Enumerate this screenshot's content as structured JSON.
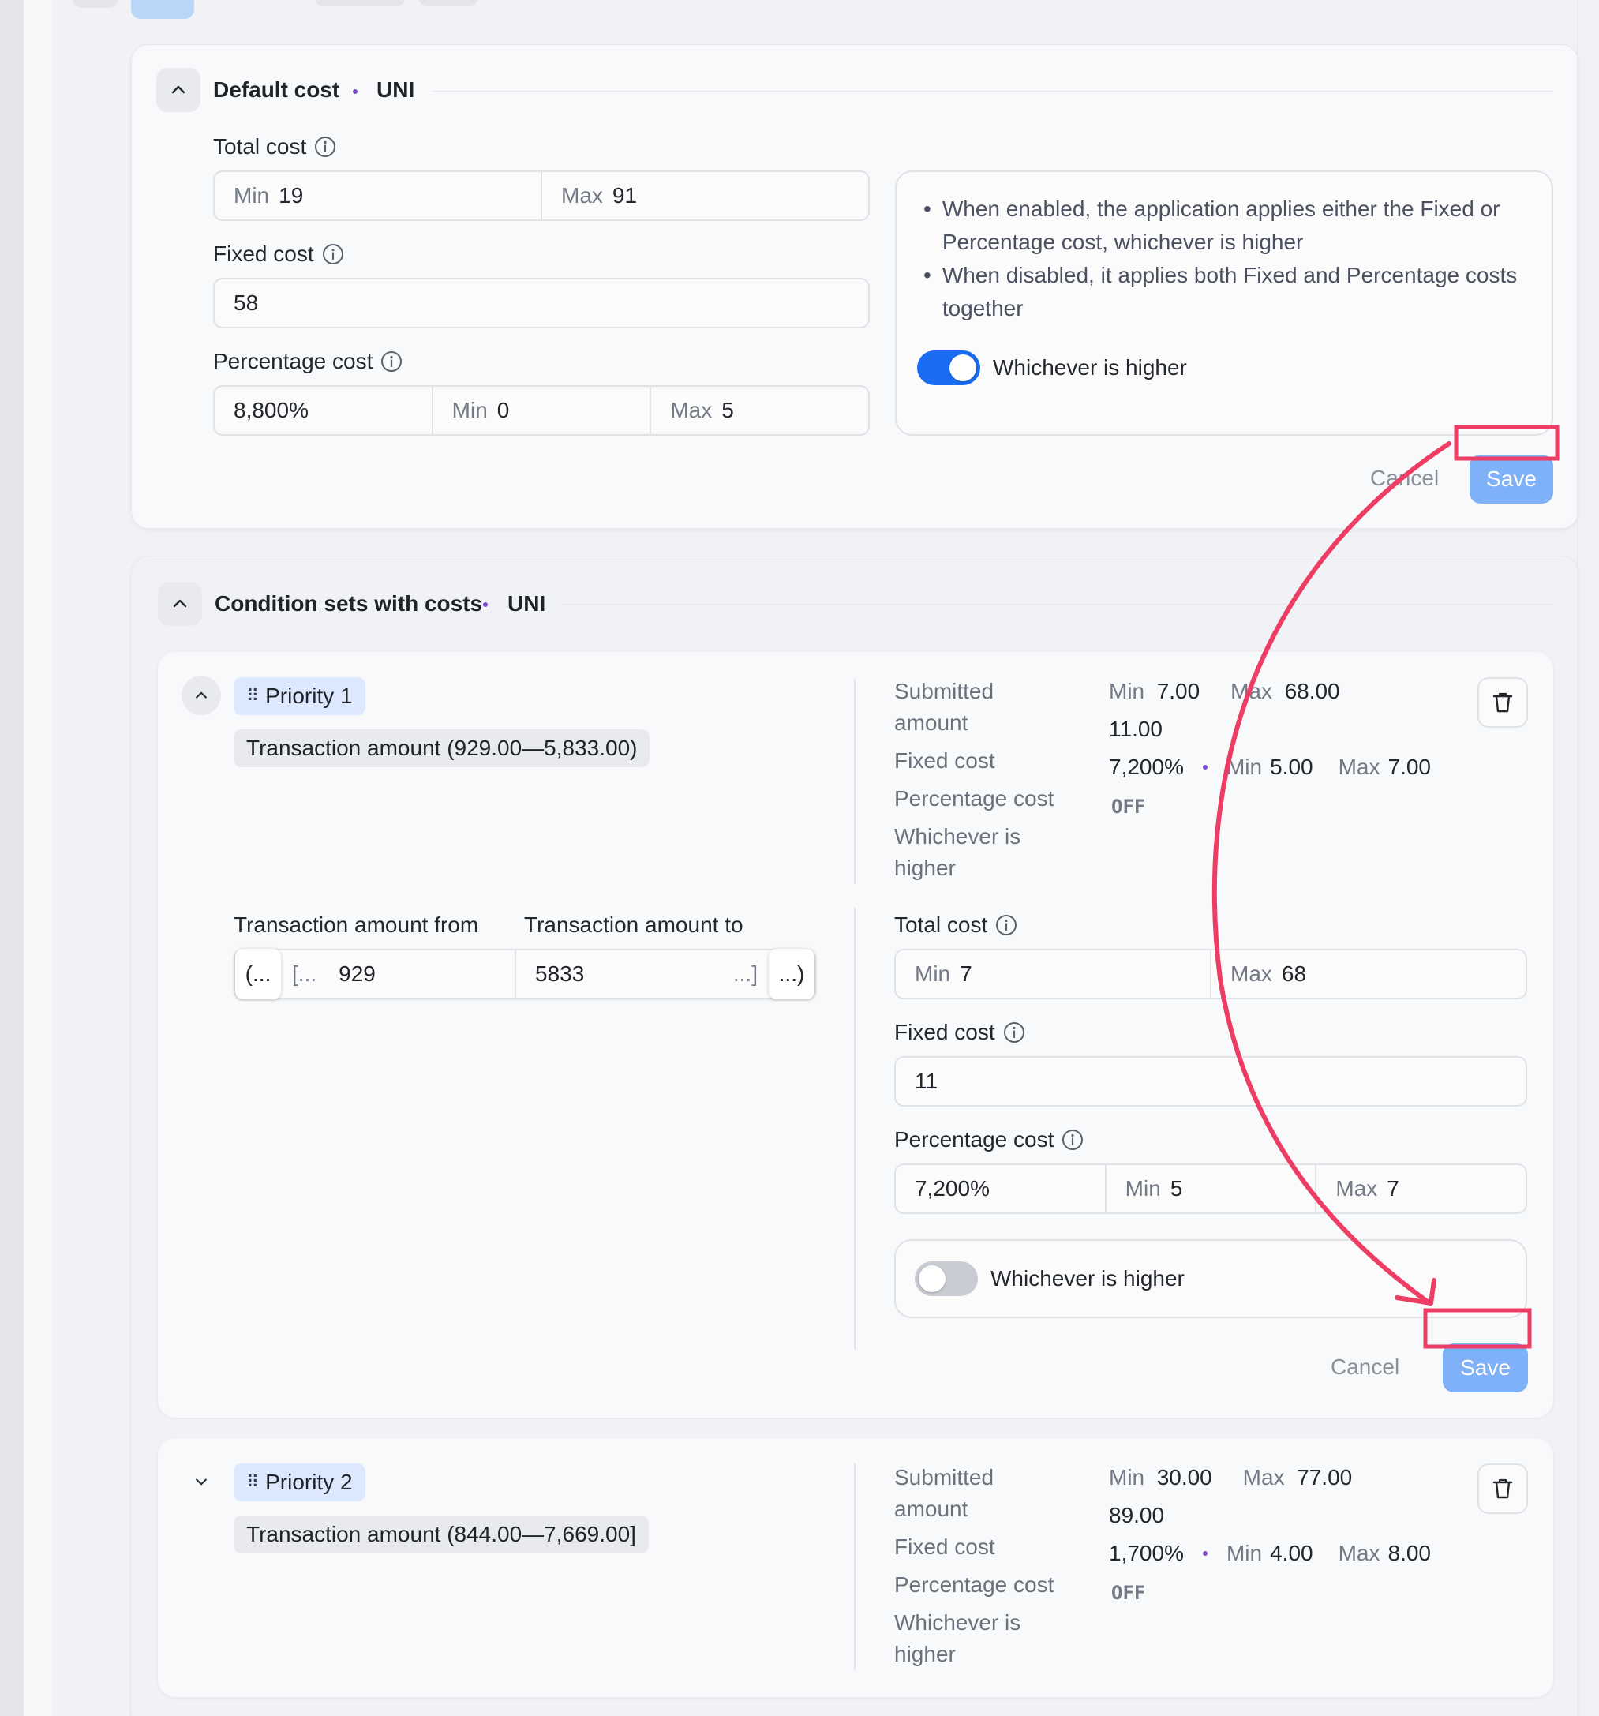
{
  "colors": {
    "accent": "#1a6df0",
    "save_button": "#7fb1f8",
    "annotation": "#ee3d64",
    "dot": "#7b4dcf"
  },
  "default_cost": {
    "title": "Default cost",
    "currency": "UNI",
    "total_cost_label": "Total cost",
    "total_min_prefix": "Min",
    "total_min": "19",
    "total_max_prefix": "Max",
    "total_max": "91",
    "fixed_cost_label": "Fixed cost",
    "fixed_cost": "58",
    "percentage_cost_label": "Percentage cost",
    "percentage": "8,800%",
    "pct_min_prefix": "Min",
    "pct_min": "0",
    "pct_max_prefix": "Max",
    "pct_max": "5",
    "info_bullet_1": "When enabled, the application applies either the Fixed or Percentage cost, whichever is higher",
    "info_bullet_2": "When disabled, it applies both Fixed and Percentage costs together",
    "toggle_label": "Whichever is higher",
    "toggle_on": true,
    "cancel": "Cancel",
    "save": "Save"
  },
  "condition_sets": {
    "title": "Condition sets with costs",
    "currency": "UNI",
    "priorities": [
      {
        "tag": "Priority 1",
        "chip": "Transaction amount (929.00—5,833.00)",
        "summary_labels": {
          "submitted": "Submitted amount",
          "fixed": "Fixed cost",
          "percentage": "Percentage cost",
          "whichever": "Whichever is higher"
        },
        "summary": {
          "submitted_min_prefix": "Min",
          "submitted_min": "7.00",
          "submitted_max_prefix": "Max",
          "submitted_max": "68.00",
          "fixed": "11.00",
          "percentage": "7,200%",
          "pct_min_prefix": "Min",
          "pct_min": "5.00",
          "pct_max_prefix": "Max",
          "pct_max": "7.00",
          "whichever": "OFF"
        },
        "range": {
          "from_label": "Transaction amount from",
          "to_label": "Transaction amount to",
          "left_open": "(...",
          "from_bracket": "[...",
          "from_value": "929",
          "to_value": "5833",
          "to_bracket": "...]",
          "right_open": "...)"
        },
        "form": {
          "total_cost_label": "Total cost",
          "total_min_prefix": "Min",
          "total_min": "7",
          "total_max_prefix": "Max",
          "total_max": "68",
          "fixed_cost_label": "Fixed cost",
          "fixed_cost": "11",
          "percentage_cost_label": "Percentage cost",
          "percentage": "7,200%",
          "pct_min_prefix": "Min",
          "pct_min": "5",
          "pct_max_prefix": "Max",
          "pct_max": "7",
          "toggle_label": "Whichever is higher",
          "toggle_on": false,
          "cancel": "Cancel",
          "save": "Save"
        }
      },
      {
        "tag": "Priority 2",
        "chip": "Transaction amount (844.00—7,669.00]",
        "summary_labels": {
          "submitted": "Submitted amount",
          "fixed": "Fixed cost",
          "percentage": "Percentage cost",
          "whichever": "Whichever is higher"
        },
        "summary": {
          "submitted_min_prefix": "Min",
          "submitted_min": "30.00",
          "submitted_max_prefix": "Max",
          "submitted_max": "77.00",
          "fixed": "89.00",
          "percentage": "1,700%",
          "pct_min_prefix": "Min",
          "pct_min": "4.00",
          "pct_max_prefix": "Max",
          "pct_max": "8.00",
          "whichever": "OFF"
        }
      }
    ]
  }
}
